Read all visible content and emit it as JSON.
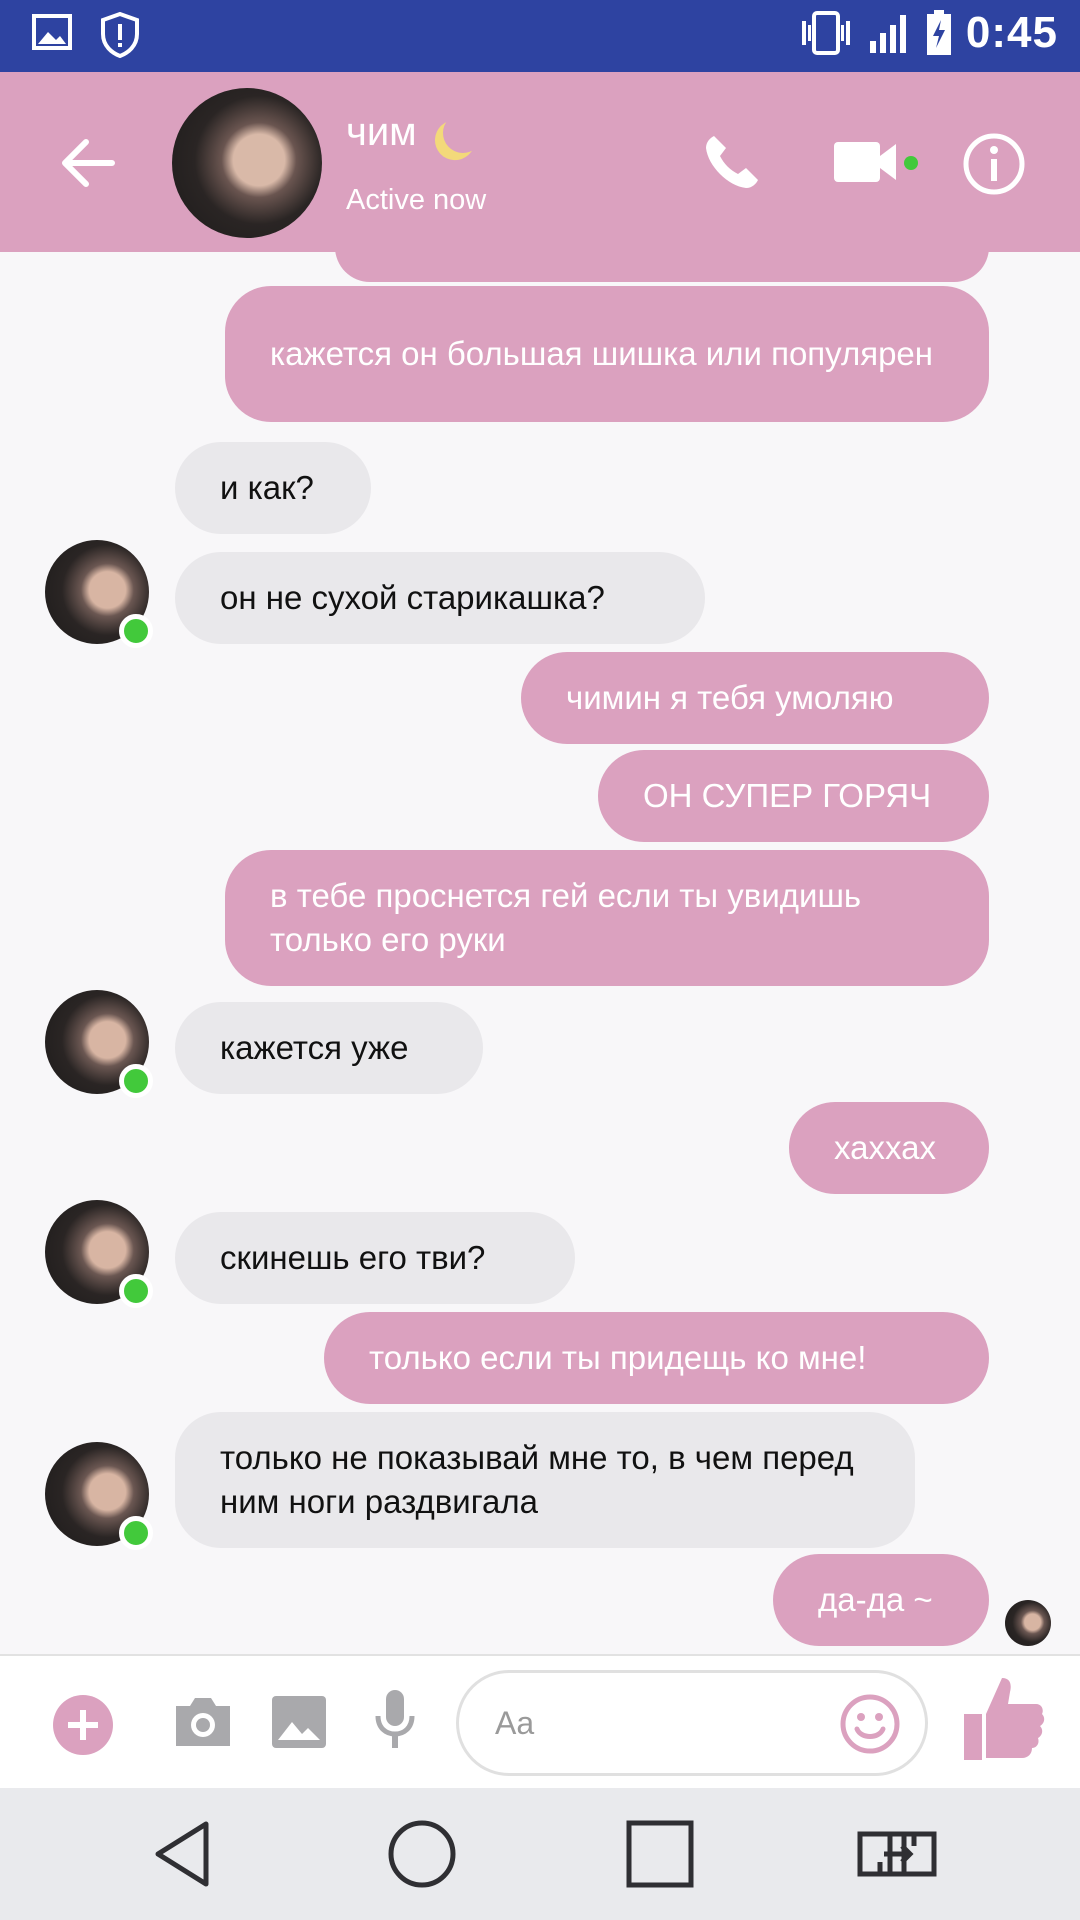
{
  "status_bar": {
    "time": "0:45",
    "icons": [
      "image-icon",
      "shield-alert-icon",
      "vibrate-icon",
      "signal-icon",
      "battery-charging-icon"
    ],
    "color": "#2e43a1"
  },
  "header": {
    "contact_name": "чим",
    "status": "Active now",
    "accent_color": "#dba1bf",
    "icons": [
      "back-arrow-icon",
      "phone-icon",
      "video-camera-icon",
      "info-icon"
    ]
  },
  "messages": [
    {
      "dir": "out",
      "text": "кажется он большая шишка или популярен"
    },
    {
      "dir": "in",
      "text": "и как?"
    },
    {
      "dir": "in",
      "text": "он не сухой старикашка?"
    },
    {
      "dir": "out",
      "text": "чимин я тебя умоляю"
    },
    {
      "dir": "out",
      "text": "ОН СУПЕР ГОРЯЧ"
    },
    {
      "dir": "out",
      "text": "в тебе проснется гей если ты увидишь только его руки"
    },
    {
      "dir": "in",
      "text": "кажется уже"
    },
    {
      "dir": "out",
      "text": "хаххах"
    },
    {
      "dir": "in",
      "text": "скинешь его тви?"
    },
    {
      "dir": "out",
      "text": "только если ты придещь ко мне!"
    },
    {
      "dir": "in",
      "text": "только не показывай мне то, в чем перед ним ноги раздвигала"
    },
    {
      "dir": "out",
      "text": "да-да ~"
    }
  ],
  "composer": {
    "placeholder": "Aa",
    "icons": [
      "plus-icon",
      "camera-icon",
      "gallery-icon",
      "microphone-icon",
      "emoji-icon",
      "thumbs-up-icon"
    ]
  },
  "nav_bar": {
    "icons": [
      "back-triangle-icon",
      "home-circle-icon",
      "recents-square-icon",
      "switch-app-icon"
    ]
  }
}
